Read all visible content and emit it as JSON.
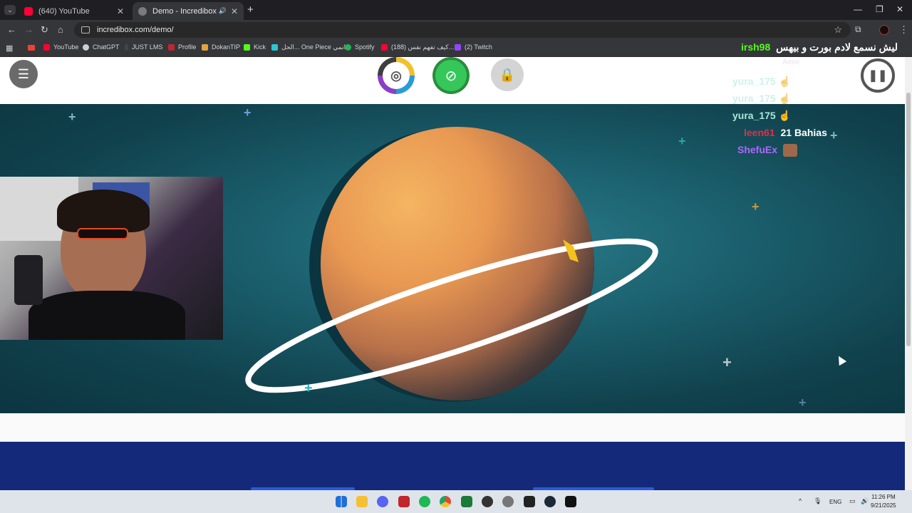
{
  "browser": {
    "tabs": [
      {
        "title": "(640) YouTube",
        "favicon_color": "#ff0033",
        "active": false
      },
      {
        "title": "Demo - Incredibox",
        "favicon_color": "#7b7b7b",
        "active": true
      }
    ],
    "new_tab_icon": "plus-icon",
    "address": "incredibox.com/demo/",
    "bookmarks": [
      {
        "label": "YouTube",
        "color": "#ff0033"
      },
      {
        "label": "ChatGPT",
        "color": "#cfcfcf"
      },
      {
        "label": "JUST LMS",
        "color": "#444"
      },
      {
        "label": "Profile",
        "color": "#c0262d"
      },
      {
        "label": "DokanTIP",
        "color": "#e3a33b"
      },
      {
        "label": "Kick",
        "color": "#53fc18"
      },
      {
        "label": "الحل... One Piece انمي",
        "color": "#2ec4d4"
      },
      {
        "label": "Spotify",
        "color": "#1db954"
      },
      {
        "label": "(188) كيف تفهم نفس...",
        "color": "#ff0033"
      },
      {
        "label": "(2) Twitch",
        "color": "#9146ff"
      }
    ]
  },
  "stream_title": {
    "user": "irsh98",
    "message": "ليش نسمع لادم بورت و بيهس"
  },
  "chat": [
    {
      "user": "Aene",
      "message": "",
      "user_color": "#d8d8d8"
    },
    {
      "user": "yura_175",
      "message": "",
      "user_color": "#a6e8d8"
    },
    {
      "user": "yura_175",
      "message": "",
      "user_color": "#a6e8d8"
    },
    {
      "user": "yura_175",
      "message": "",
      "user_color": "#a6e8d8"
    },
    {
      "user": "leen61",
      "message": "21 Bahias",
      "user_color": "#d9314e"
    },
    {
      "user": "ShefuEx",
      "message": "",
      "user_color": "#b065ff"
    }
  ],
  "game": {
    "menu_icon": "hamburger-icon",
    "modes": [
      {
        "name": "vinyl-mode-icon",
        "color": "#555"
      },
      {
        "name": "wekiddy-mode-icon",
        "color": "#2bb24c"
      },
      {
        "name": "lock-icon",
        "color": "#d4d4d4"
      }
    ],
    "pause_icon": "pause-icon"
  },
  "taskbar": {
    "apps": [
      {
        "name": "windows-start-icon",
        "color": "#1e6fd9"
      },
      {
        "name": "file-explorer-icon",
        "color": "#f5c033"
      },
      {
        "name": "discord-icon",
        "color": "#5865f2"
      },
      {
        "name": "media-app-icon",
        "color": "#c0262d"
      },
      {
        "name": "spotify-icon",
        "color": "#1db954"
      },
      {
        "name": "chrome-icon",
        "color": "#de4b39"
      },
      {
        "name": "app-green-icon",
        "color": "#1b7a3a"
      },
      {
        "name": "app-dark-icon",
        "color": "#333"
      },
      {
        "name": "settings-icon",
        "color": "#777"
      },
      {
        "name": "epic-games-icon",
        "color": "#222"
      },
      {
        "name": "steam-icon",
        "color": "#1b2838"
      },
      {
        "name": "terminal-icon",
        "color": "#111"
      }
    ],
    "language": "ENG",
    "time": "11:26 PM",
    "date": "9/21/2025"
  }
}
